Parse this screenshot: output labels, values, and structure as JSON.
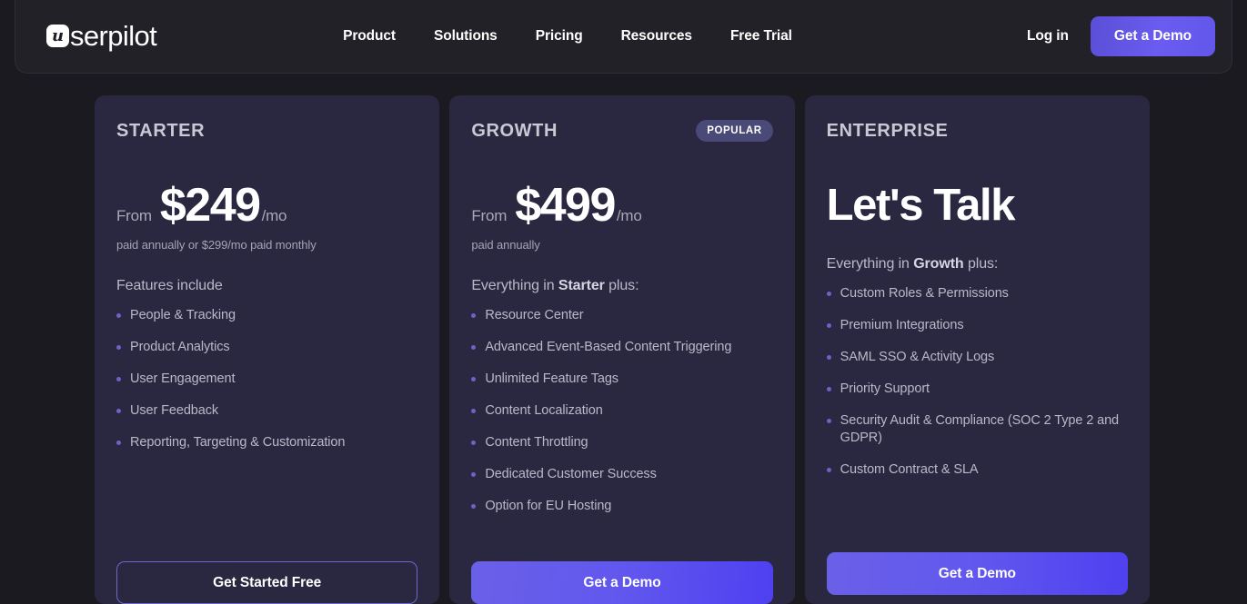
{
  "colors": {
    "page_bg": "#1a1a20",
    "header_bg": "#212127",
    "card_bg": "#2a2840",
    "accent": "#6157ee",
    "badge_bg": "#494a77",
    "bullet": "#6c63c8"
  },
  "header": {
    "logo_mark": "u",
    "logo_text": "serpilot",
    "nav": [
      {
        "label": "Product"
      },
      {
        "label": "Solutions"
      },
      {
        "label": "Pricing"
      },
      {
        "label": "Resources"
      },
      {
        "label": "Free Trial"
      }
    ],
    "login_label": "Log in",
    "demo_label": "Get a Demo"
  },
  "plans": [
    {
      "name": "STARTER",
      "badge": null,
      "price_from": "From",
      "price_amount": "$249",
      "price_period": "/mo",
      "price_note": "paid annually or $299/mo paid monthly",
      "features_title_plain": "Features include",
      "features": [
        "People & Tracking",
        "Product Analytics",
        "User Engagement",
        "User Feedback",
        "Reporting, Targeting & Customization"
      ],
      "cta_label": "Get Started Free",
      "cta_style": "outline"
    },
    {
      "name": "GROWTH",
      "badge": "POPULAR",
      "price_from": "From",
      "price_amount": "$499",
      "price_period": "/mo",
      "price_note": "paid annually",
      "features_title_prefix": "Everything in ",
      "features_title_bold": "Starter",
      "features_title_suffix": " plus:",
      "features": [
        "Resource Center",
        "Advanced Event-Based Content Triggering",
        "Unlimited Feature Tags",
        "Content Localization",
        "Content Throttling",
        "Dedicated Customer Success",
        "Option for EU Hosting"
      ],
      "cta_label": "Get a Demo",
      "cta_style": "filled"
    },
    {
      "name": "ENTERPRISE",
      "badge": null,
      "headline": "Let's Talk",
      "features_title_prefix": "Everything in ",
      "features_title_bold": "Growth",
      "features_title_suffix": " plus:",
      "features": [
        "Custom Roles & Permissions",
        "Premium Integrations",
        "SAML SSO & Activity Logs",
        "Priority Support",
        "Security Audit & Compliance (SOC 2 Type 2 and GDPR)",
        "Custom Contract & SLA"
      ],
      "cta_label": "Get a Demo",
      "cta_style": "filled"
    }
  ]
}
